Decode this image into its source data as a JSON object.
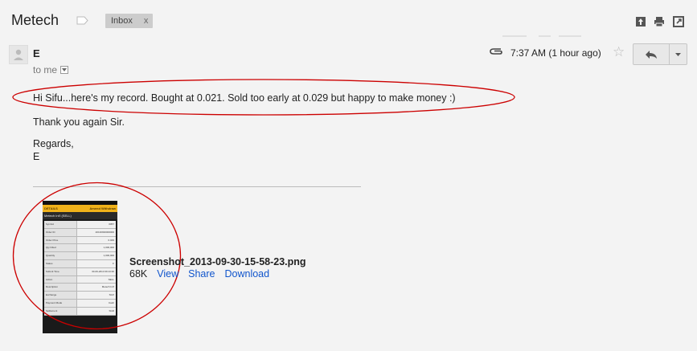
{
  "thread": {
    "subject": "Metech",
    "label": "Inbox",
    "label_remove": "x"
  },
  "toolbar": {
    "icons": [
      "archive-icon",
      "print-icon",
      "new-window-icon"
    ]
  },
  "message": {
    "sender": "E",
    "recipient": "to me",
    "time": "7:37 AM (1 hour ago)",
    "body": [
      "Hi Sifu...here's my record. Bought at 0.021. Sold too early at 0.029 but happy to make money :)",
      "Thank you again Sir.",
      "Regards,",
      "E"
    ]
  },
  "attachment": {
    "filename": "Screenshot_2013-09-30-15-58-23.png",
    "size": "68K",
    "actions": [
      "View",
      "Share",
      "Download"
    ],
    "thumbnail": {
      "header_left": "DETAILS",
      "header_right": "Amend  Withdraw",
      "title": "Metech Int'l (SELL)",
      "rows": [
        {
          "k": "Symbol",
          "v": "0057"
        },
        {
          "k": "Order ID",
          "v": "20130930000000"
        },
        {
          "k": "Order Price",
          "v": "0.029"
        },
        {
          "k": "Qty Filled",
          "v": "1,000,000"
        },
        {
          "k": "Quantity",
          "v": "1,000,000"
        },
        {
          "k": "Status",
          "v": "F"
        },
        {
          "k": "Submit Time",
          "v": "30-09-2013 09:13:36"
        },
        {
          "k": "Action",
          "v": "SELL"
        },
        {
          "k": "Description",
          "v": "Metech Int'l"
        },
        {
          "k": "Exchange",
          "v": "SGX"
        },
        {
          "k": "Payment Mode",
          "v": "Cash"
        },
        {
          "k": "Settlement",
          "v": "SGD"
        }
      ]
    }
  },
  "colors": {
    "background": "#f3f3f3",
    "link": "#1155cc",
    "annotation": "#cc0000",
    "thumb_accent": "#f0b21a"
  }
}
